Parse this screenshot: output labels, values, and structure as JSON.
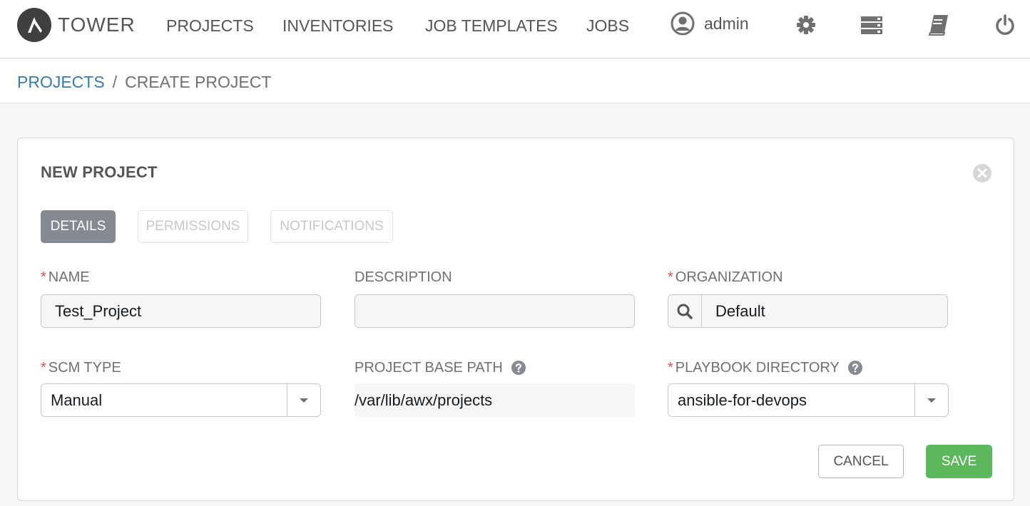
{
  "nav": {
    "brand": "TOWER",
    "links": [
      "PROJECTS",
      "INVENTORIES",
      "JOB TEMPLATES",
      "JOBS"
    ],
    "user": "admin",
    "icons": [
      "user-circle-icon",
      "gear-icon",
      "server-icon",
      "book-icon",
      "power-icon"
    ]
  },
  "breadcrumb": {
    "parent": "PROJECTS",
    "separator": "/",
    "current": "CREATE PROJECT"
  },
  "panel": {
    "title": "NEW PROJECT",
    "tabs": [
      {
        "label": "DETAILS",
        "active": true
      },
      {
        "label": "PERMISSIONS",
        "active": false
      },
      {
        "label": "NOTIFICATIONS",
        "active": false
      }
    ]
  },
  "form": {
    "name": {
      "label": "NAME",
      "required": true,
      "value": "Test_Project"
    },
    "description": {
      "label": "DESCRIPTION",
      "required": false,
      "value": ""
    },
    "organization": {
      "label": "ORGANIZATION",
      "required": true,
      "value": "Default"
    },
    "scm_type": {
      "label": "SCM TYPE",
      "required": true,
      "value": "Manual"
    },
    "base_path": {
      "label": "PROJECT BASE PATH",
      "value": "/var/lib/awx/projects"
    },
    "playbook_dir": {
      "label": "PLAYBOOK DIRECTORY",
      "required": true,
      "value": "ansible-for-devops"
    },
    "required_mark": "*"
  },
  "actions": {
    "cancel": "CANCEL",
    "save": "SAVE"
  },
  "colors": {
    "link": "#337ab7",
    "required": "#d9534f",
    "save": "#5cb85c",
    "active_tab": "#848992"
  }
}
